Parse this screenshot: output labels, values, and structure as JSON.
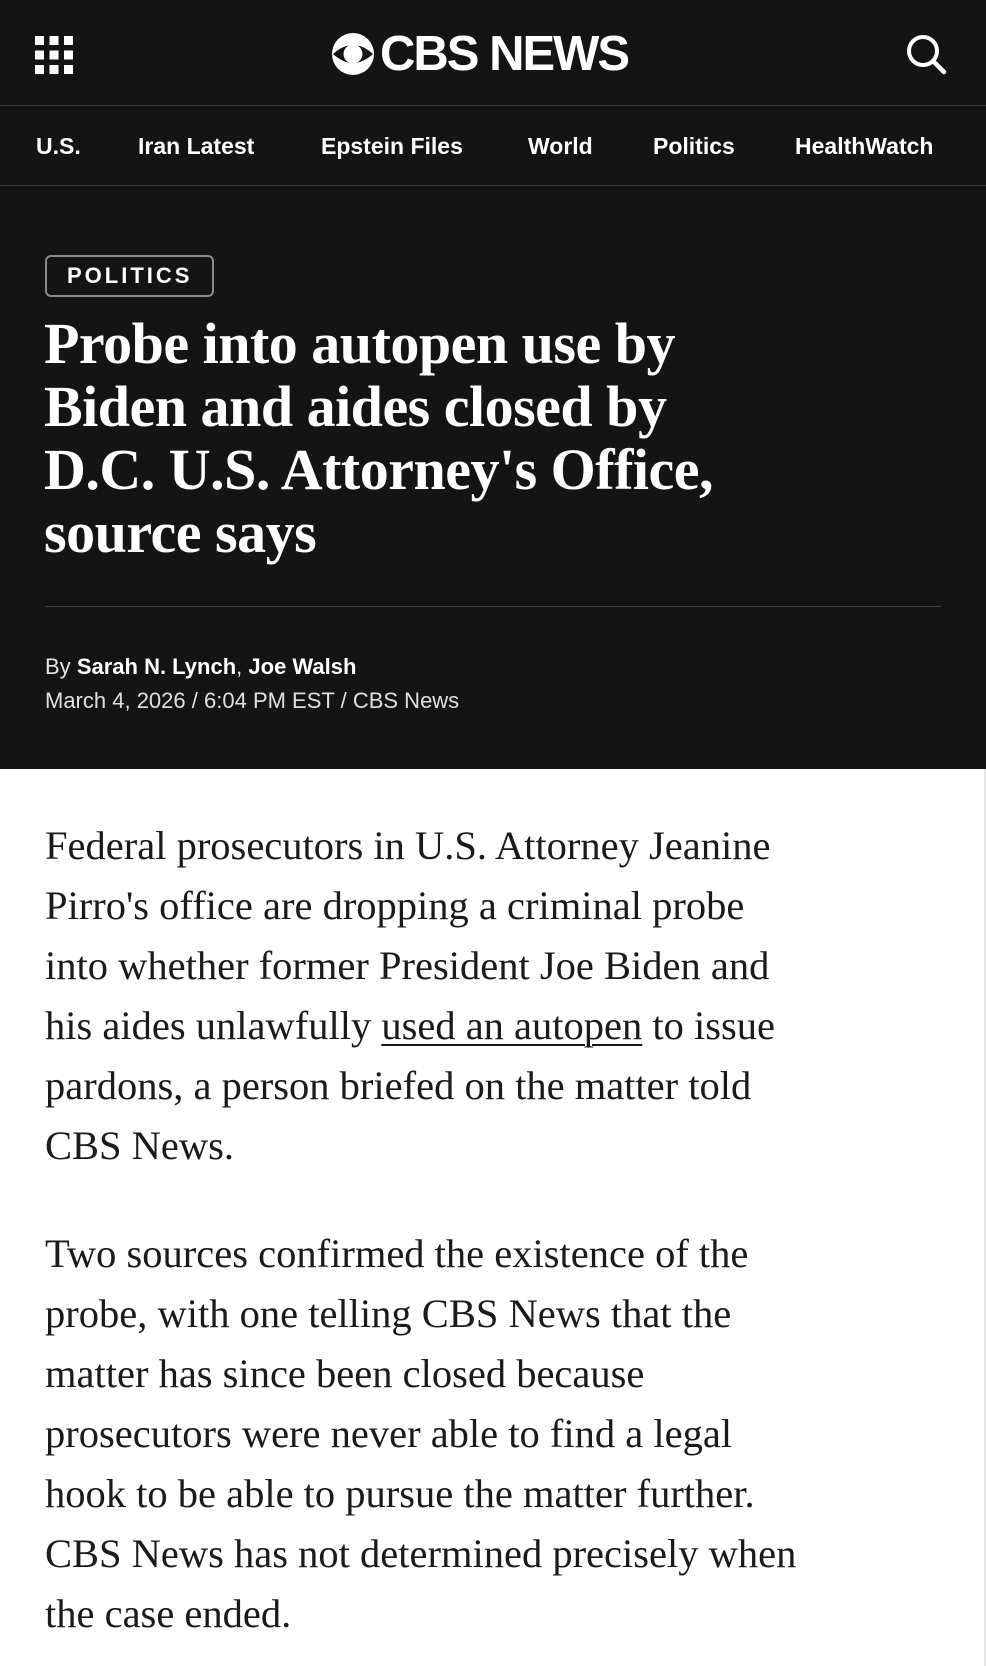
{
  "header": {
    "logo_text": "CBS NEWS",
    "menu_icon": "grid-menu-icon",
    "search_icon": "search-icon",
    "background_color": "#141414"
  },
  "nav": {
    "items": [
      {
        "label": "U.S."
      },
      {
        "label": "Iran Latest"
      },
      {
        "label": "Epstein Files"
      },
      {
        "label": "World"
      },
      {
        "label": "Politics"
      },
      {
        "label": "HealthWatch"
      }
    ]
  },
  "article": {
    "category": "POLITICS",
    "headline_lines": [
      "Probe into autopen use by",
      "Biden and aides closed by",
      "D.C. U.S. Attorney's Office,",
      "source says"
    ],
    "byline_prefix": "By",
    "authors": [
      "Sarah N. Lynch",
      "Joe Walsh"
    ],
    "author_separator": ",",
    "date": "March 4, 2026",
    "time": "6:04 PM EST",
    "source": "CBS News",
    "meta_separator": "/",
    "paragraph1": {
      "line1": "Federal prosecutors in U.S. Attorney Jeanine",
      "line2": "Pirro's office are dropping a criminal probe",
      "line3": "into whether former President Joe Biden and",
      "line4_before_link": "his aides unlawfully",
      "line4_link": "used an autopen",
      "line4_after_link": "to issue",
      "line5": "pardons, a person briefed on the matter told",
      "line6": "CBS News."
    },
    "paragraph2_lines": [
      "Two sources confirmed the existence of the",
      "probe, with one telling CBS News that the",
      "matter has since been closed because",
      "prosecutors were never able to find a legal",
      "hook to be able to pursue the matter further.",
      "CBS News has not determined precisely when",
      "the case ended."
    ]
  }
}
